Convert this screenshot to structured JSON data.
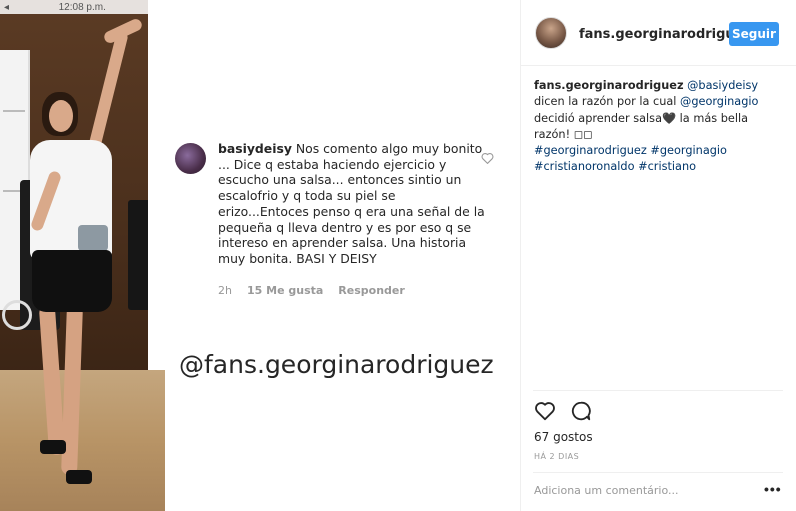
{
  "photo": {
    "status_time": "12:08 p.m."
  },
  "comment": {
    "username": "basiydeisy",
    "text": "Nos comento algo muy bonito ... Dice q estaba haciendo ejercicio y escucho una salsa... entonces sintio un escalofrio y q toda su piel se erizo...Entoces penso q era una señal de la pequeña q lleva dentro y es por eso q se intereso en aprender salsa. Una historia muy bonita. BASI Y DEISY",
    "time": "2h",
    "likes": "15 Me gusta",
    "reply": "Responder",
    "like_icon": "heart-outline-icon"
  },
  "watermark": "@fans.georginarodriguez",
  "post": {
    "username": "fans.georginarodriguez",
    "follow_label": "Seguir",
    "follow_color": "#3897f0",
    "caption": {
      "author": "fans.georginarodriguez",
      "mention1": "@basiydeisy",
      "part1": " dicen la razón por la cual ",
      "mention2": "@georginagio",
      "part2": " decidió aprender salsa",
      "emoji1": "🖤",
      "part3": " la más bella razón! ",
      "emoji2": "◻◻",
      "hashtags": [
        "#georginarodriguez",
        "#georginagio",
        "#cristianoronaldo",
        "#cristiano"
      ]
    },
    "likes": "67 gostos",
    "time_ago": "HÁ 2 DIAS",
    "comment_placeholder": "Adiciona um comentário...",
    "more_label": "•••",
    "icons": {
      "like": "heart-icon",
      "comment": "comment-bubble-icon"
    },
    "link_color": "#003569"
  }
}
